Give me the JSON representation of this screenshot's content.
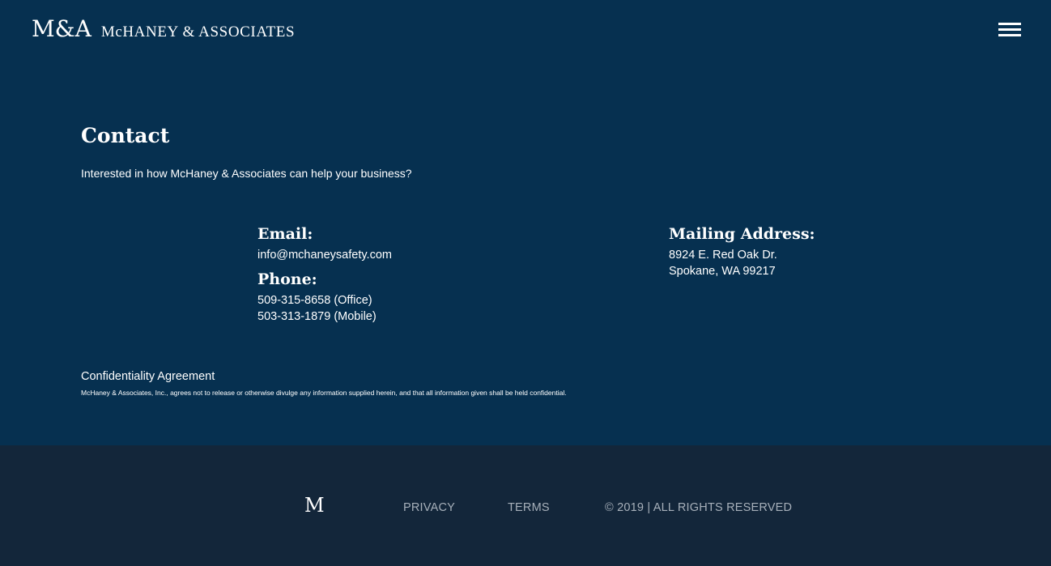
{
  "header": {
    "logo_mark": "M&A",
    "logo_text": "McHANEY & ASSOCIATES",
    "menu_icon": "hamburger-menu-icon"
  },
  "contact": {
    "title": "Contact",
    "intro": "Interested in how McHaney & Associates can help your business?",
    "email_heading": "Email:",
    "email": "info@mchaneysafety.com",
    "phone_heading": "Phone:",
    "phone_office": "509-315-8658 (Office)",
    "phone_mobile": "503-313-1879 (Mobile)",
    "address_heading": "Mailing Address:",
    "address_line1": "8924 E. Red Oak Dr.",
    "address_line2": "Spokane, WA 99217"
  },
  "confidentiality": {
    "title": "Confidentiality Agreement",
    "text": "McHaney & Associates, Inc., agrees not to release or otherwise divulge any information supplied herein, and that all information given shall be held confidential."
  },
  "footer": {
    "logo_mark": "M",
    "privacy_label": "PRIVACY",
    "terms_label": "TERMS",
    "copyright": "© 2019 | ALL RIGHTS RESERVED"
  },
  "colors": {
    "main_background": "#063050",
    "footer_background": "#13263a",
    "footer_text": "#a7b0ba",
    "text": "#ffffff"
  }
}
